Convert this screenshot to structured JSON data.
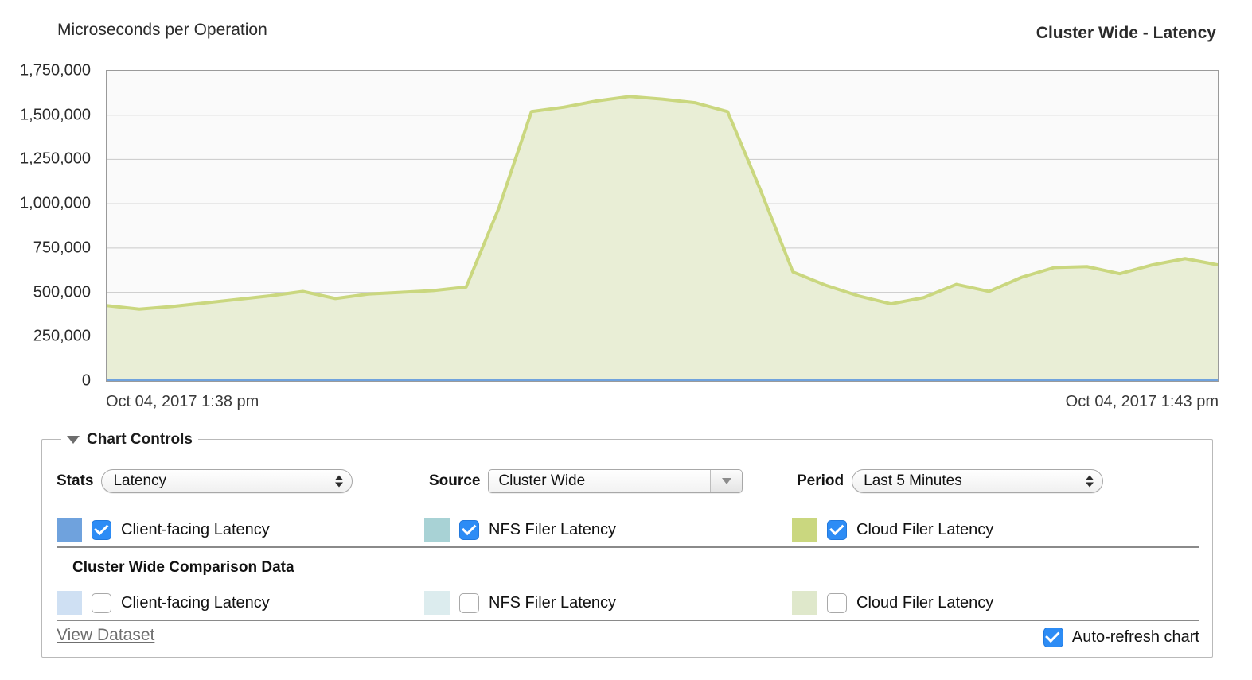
{
  "header": {
    "units_label": "Microseconds per Operation",
    "title": "Cluster Wide - Latency"
  },
  "chart_data": {
    "type": "area",
    "title": "Cluster Wide - Latency",
    "subtitle": "",
    "xlabel": "",
    "ylabel": "Microseconds per Operation",
    "ylim": [
      0,
      1750000
    ],
    "ytick_labels": [
      "1,750,000",
      "1,500,000",
      "1,250,000",
      "1,000,000",
      "750,000",
      "500,000",
      "250,000",
      "0"
    ],
    "yticks": [
      1750000,
      1500000,
      1250000,
      1000000,
      750000,
      500000,
      250000,
      0
    ],
    "grid": true,
    "legend_position": "below-chart",
    "x_start_label": "Oct 04, 2017 1:38 pm",
    "x_end_label": "Oct 04, 2017 1:43 pm",
    "x_range": [
      "Oct 04, 2017 1:38 pm",
      "Oct 04, 2017 1:43 pm"
    ],
    "x": [
      0,
      1,
      2,
      3,
      4,
      5,
      6,
      7,
      8,
      9,
      10,
      11,
      12,
      13,
      14,
      15,
      16,
      17,
      18,
      19,
      20,
      21,
      22,
      23,
      24,
      25,
      26,
      27,
      28,
      29
    ],
    "series": [
      {
        "name": "Cloud Filer Latency",
        "color": "#cad77f",
        "fill": "#e9eed6",
        "visible": true,
        "values": [
          425000,
          405000,
          420000,
          440000,
          460000,
          480000,
          505000,
          465000,
          490000,
          500000,
          510000,
          530000,
          975000,
          1520000,
          1545000,
          1580000,
          1605000,
          1590000,
          1570000,
          1520000,
          1080000,
          615000,
          540000,
          480000,
          435000,
          470000,
          545000,
          505000,
          585000,
          640000,
          645000,
          605000,
          655000,
          690000,
          655000
        ]
      },
      {
        "name": "NFS Filer Latency",
        "color": "#a8d2d5",
        "fill": "#d7e9ea",
        "visible": true,
        "values": [
          0,
          0,
          0,
          0,
          0,
          0,
          0,
          0,
          0,
          0,
          0,
          0,
          0,
          0,
          0,
          0,
          0,
          0,
          0,
          0,
          0,
          0,
          0,
          0,
          0,
          0,
          0,
          0,
          0,
          0,
          0,
          0,
          0,
          0,
          0
        ]
      },
      {
        "name": "Client-facing Latency",
        "color": "#6fa2dd",
        "fill": "#cfe0f3",
        "visible": true,
        "values": [
          0,
          0,
          0,
          0,
          0,
          0,
          0,
          0,
          0,
          0,
          0,
          0,
          0,
          0,
          0,
          0,
          0,
          0,
          0,
          0,
          0,
          0,
          0,
          0,
          0,
          0,
          0,
          0,
          0,
          0,
          0,
          0,
          0,
          0,
          0
        ]
      }
    ]
  },
  "controls": {
    "section_title": "Chart Controls",
    "collapsed": false,
    "stats": {
      "label": "Stats",
      "value": "Latency"
    },
    "source": {
      "label": "Source",
      "value": "Cluster Wide"
    },
    "period": {
      "label": "Period",
      "value": "Last 5 Minutes"
    },
    "primary_legend": [
      {
        "label": "Client-facing Latency",
        "color": "#6fa2dd",
        "checked": true
      },
      {
        "label": "NFS Filer Latency",
        "color": "#a8d2d5",
        "checked": true
      },
      {
        "label": "Cloud Filer Latency",
        "color": "#cad77f",
        "checked": true
      }
    ],
    "comparison_heading": "Cluster Wide Comparison Data",
    "comparison_legend": [
      {
        "label": "Client-facing Latency",
        "color": "#cfe0f3",
        "checked": false
      },
      {
        "label": "NFS Filer Latency",
        "color": "#dcecee",
        "checked": false
      },
      {
        "label": "Cloud Filer Latency",
        "color": "#dfe8cb",
        "checked": false
      }
    ],
    "view_dataset_label": "View Dataset",
    "auto_refresh_label": "Auto-refresh chart",
    "auto_refresh_checked": true
  }
}
